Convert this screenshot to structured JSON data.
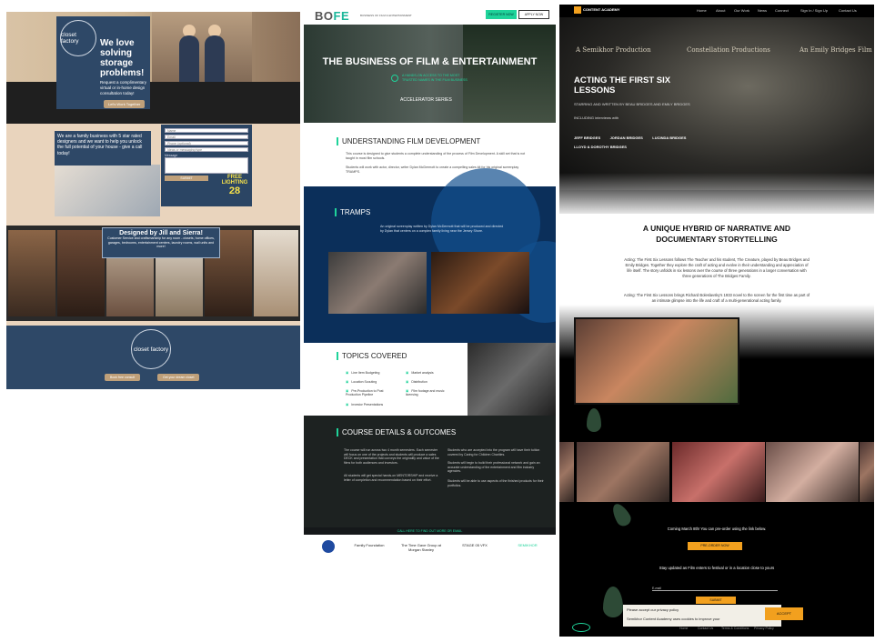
{
  "p1": {
    "logo_text": "closet factory",
    "hero_title": "We love solving storage problems!",
    "hero_sub": "Request a complimentary virtual or in-home design consultation today!",
    "hero_btn": "Let's Work Together",
    "family_text": "We are a family business with 5 star rated designers and we want to help you unlock the full potential of your house - give a call today!",
    "form_fields": [
      "Name",
      "Email",
      "Phone (optional)",
      "Ideas or messaging type"
    ],
    "form_message": "Message",
    "form_submit": "SUBMIT",
    "badge_free": "FREE LIGHTING",
    "badge_num": "28",
    "banner_title": "Designed by Jill and Sierra!",
    "banner_sub": "Customer Service and craftsmanship for any room - closets, home offices, garages, bedrooms, entertainment centers, laundry rooms, wall units and more!",
    "footer_btn1": "Book free consult",
    "footer_btn2": "Get your dream closet"
  },
  "p2": {
    "logo_bo": "BO",
    "logo_fe": "FE",
    "logo_tag": "BUSINESS OF FILM & ENTERTAINMENT",
    "btn_green": "REGISTER NOW",
    "btn_white": "APPLY NOW",
    "hero_title": "THE BUSINESS OF FILM & ENTERTAINMENT",
    "hero_tag": "A HANDS-ON ACCESS TO THE MOST TRUSTED NAMES IN THE FILM BUSINESS",
    "hero_series": "ACCELERATOR SERIES",
    "sec1_title": "UNDERSTANDING FILM DEVELOPMENT",
    "sec1_p1": "This course is designed to give students a complete understanding of the process of Film Development. A skill set that is not taught in most film schools.",
    "sec1_p2": "Students will work with actor, director, writer Dylan McDermott to create a compelling sales kit for his original screenplay TRAMPS.",
    "tramps_title": "TRAMPS",
    "tramps_text": "An original screenplay written by Dylan McDermott that will be produced and directed by Dylan that centers on a complex family living near the Jersey Shore.",
    "topics_title": "TOPICS COVERED",
    "topics": [
      "Line Item Budgeting",
      "Location Scouting",
      "Pre-Production to Post Production Pipeline",
      "Investor Presentations",
      "Market analysis",
      "Distribution",
      "Film footage and music licensing"
    ],
    "course_title": "COURSE DETAILS & OUTCOMES",
    "course_left": [
      "The course will run across two 4 month semesters. Each semester will focus on one of the projects and students will produce a sales DECK and presentation that conveys the originality and value of the films for both audiences and investors.",
      "All students will get special hands-on MENTORSHIP and receive a letter of completion and recommendation based on their effort."
    ],
    "course_right": [
      "Students who are accepted into the program will have their tuition covered by Caring for Children Charities.",
      "Students will begin to build their professional network and gain an accurate understanding of the entertainment and film industry agencies.",
      "Students will be able to use aspects of the finished products for their portfolios."
    ],
    "contact": "CALL HERE TO FIND OUT MORE OR EMAIL",
    "sponsors": [
      "Family Foundation",
      "The Time Gave Group at Morgan Stanley",
      "STAGE 05 VFX",
      "SEMIKHOR"
    ]
  },
  "p3": {
    "brand": "CONTENT ACADEMY",
    "nav": [
      "Home",
      "About",
      "Our Work",
      "News",
      "Connect",
      "Sign In / Sign Up",
      "Contact Us"
    ],
    "credit1": "A Semikhor Production",
    "credit2": "Constellation Productions",
    "credit3": "An Emily Bridges Film",
    "title": "ACTING THE FIRST SIX LESSONS",
    "subtitle": "STARRING AND WRITTEN BY BEAU BRIDGES AND EMILY BRIDGES",
    "interviews": "INCLUDING interviews with",
    "names": [
      "JEFF BRIDGES",
      "JORDAN BRIDGES",
      "LUCINDA BRIDGES",
      "LLOYD & DOROTHY BRIDGES"
    ],
    "h2": "A UNIQUE HYBRID OF NARRATIVE AND DOCUMENTARY STORYTELLING",
    "para1": "Acting: The First Six Lessons follows The Teacher and his student, The Creature, played by Beau Bridges and Emily Bridges. Together they explore the craft of acting and evolve in their understanding and appreciation of life itself. The story unfolds in six lessons over the course of three generations in a larger conversation with three generations of The Bridges Family.",
    "para2": "Acting: The First Six Lessons brings Richard Boleslavsky's 1933 novel to the screen for the first time as part of an intimate glimpse into the life and craft of a multi-generational acting family.",
    "preorder": "Coming March 8th! You can pre-order using the link below.",
    "preorder_btn": "PRE-ORDER NOW",
    "update": "Stay updated as Film enters to festival or in a location close to yours",
    "email_label": "E-mail",
    "submit": "SUBMIT",
    "cookie1": "Please accept our privacy policy",
    "cookie2": "Semikhor Content Academy uses cookies to improve your",
    "accept": "ACCEPT",
    "footer": [
      "Home",
      "Contact Us",
      "Terms & Conditions",
      "Privacy Policy"
    ]
  },
  "colors": {
    "green": "#1fd39a",
    "navy": "#2e4867",
    "orange": "#f2a01e"
  }
}
